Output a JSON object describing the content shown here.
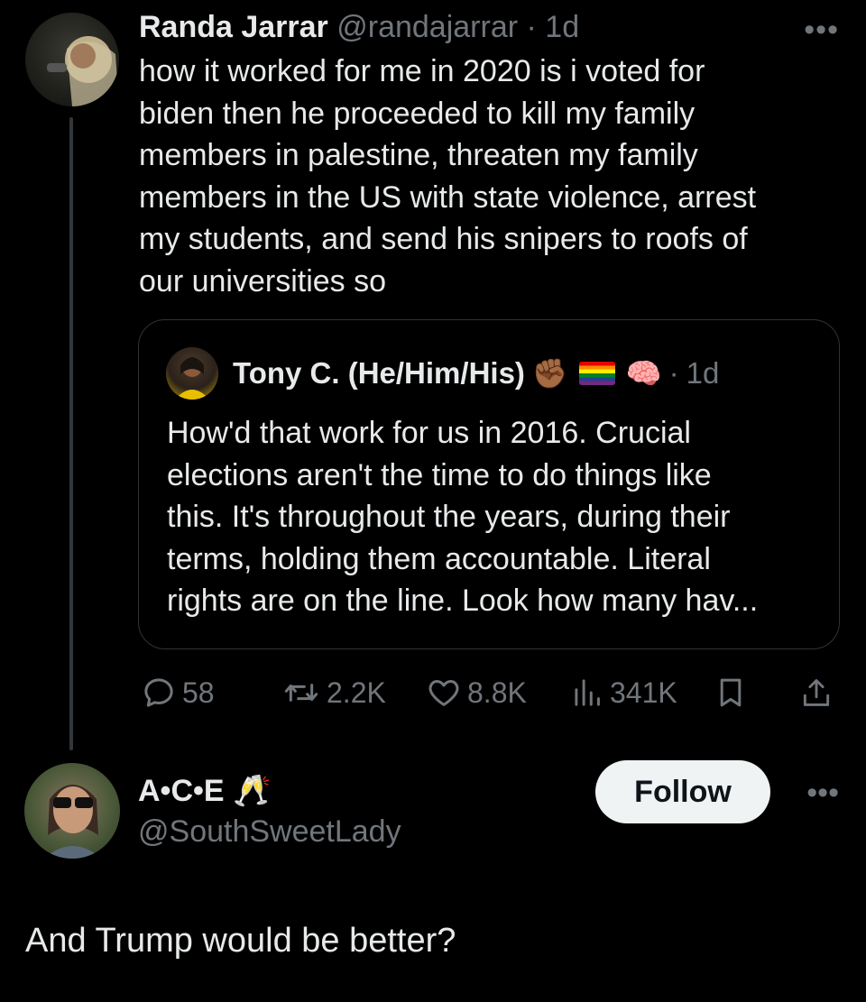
{
  "tweet": {
    "author_name": "Randa Jarrar",
    "handle": "@randajarrar",
    "separator": "·",
    "time": "1d",
    "text": "how it worked for me in 2020 is i voted for\nbiden then he proceeded to kill my family\nmembers in palestine, threaten my family\nmembers in the US with state violence, arrest\nmy students, and send his snipers to roofs of\nour universities so",
    "more_icon": "more-dots-icon"
  },
  "quote": {
    "author_name": "Tony C. (He/Him/His)",
    "emoji_fist": "✊🏾",
    "emoji_brain": "🧠",
    "separator": "·",
    "time": "1d",
    "text": "How'd that work for us in 2016. Crucial\nelections aren't the time to do things like\nthis. It's throughout the years, during their\nterms, holding them accountable. Literal\nrights are on the line. Look how many hav..."
  },
  "actions": {
    "replies": "58",
    "reposts": "2.2K",
    "likes": "8.8K",
    "views": "341K"
  },
  "reply": {
    "author_name": "A•C•E 🥂",
    "handle": "@SouthSweetLady",
    "follow_label": "Follow",
    "text": "And Trump would be better?"
  },
  "colors": {
    "background": "#000000",
    "text_primary": "#e7e9ea",
    "text_muted": "#71767b",
    "border": "#2f3336",
    "follow_bg": "#eff3f4"
  }
}
